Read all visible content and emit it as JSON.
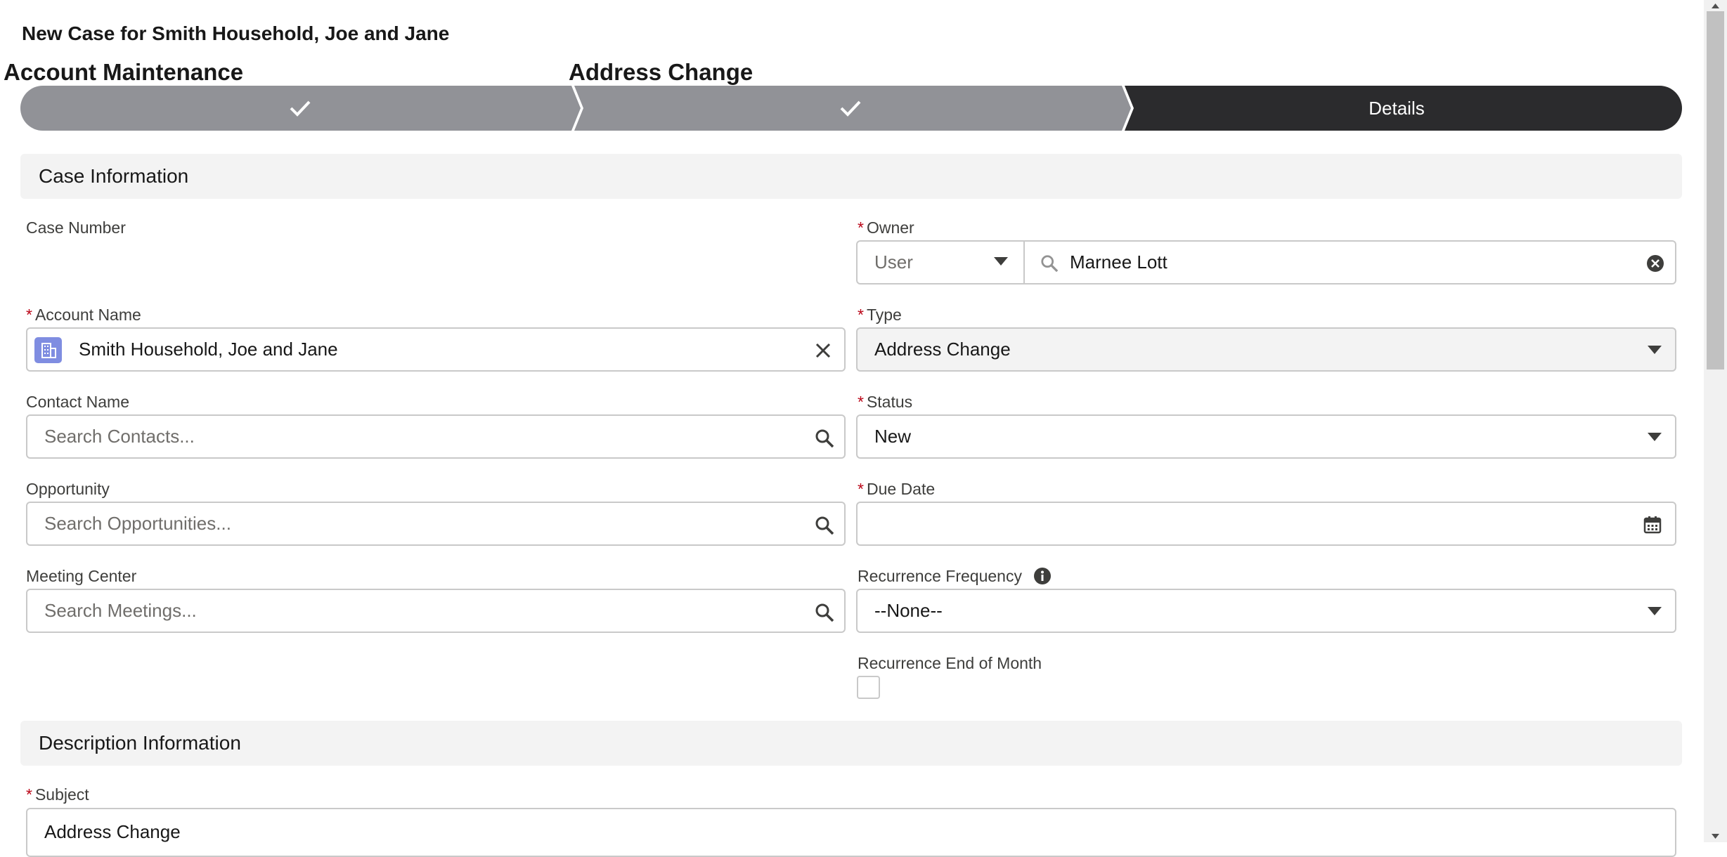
{
  "page": {
    "title": "New Case for Smith Household, Joe and Jane"
  },
  "path": {
    "step_titles": [
      "Account Maintenance",
      "Address Change"
    ],
    "stages": [
      {
        "status": "complete",
        "icon": "check-icon"
      },
      {
        "status": "complete",
        "icon": "check-icon"
      },
      {
        "status": "current",
        "label": "Details"
      }
    ]
  },
  "sections": {
    "case_information": "Case Information",
    "description_information": "Description Information"
  },
  "fields": {
    "case_number": {
      "label": "Case Number"
    },
    "owner": {
      "label": "Owner",
      "type_value": "User",
      "value": "Marnee Lott"
    },
    "account_name": {
      "label": "Account Name",
      "value": "Smith Household, Joe and Jane"
    },
    "type": {
      "label": "Type",
      "value": "Address Change"
    },
    "contact_name": {
      "label": "Contact Name",
      "placeholder": "Search Contacts..."
    },
    "status": {
      "label": "Status",
      "value": "New"
    },
    "opportunity": {
      "label": "Opportunity",
      "placeholder": "Search Opportunities..."
    },
    "due_date": {
      "label": "Due Date",
      "value": ""
    },
    "meeting_center": {
      "label": "Meeting Center",
      "placeholder": "Search Meetings..."
    },
    "recurrence_frequency": {
      "label": "Recurrence Frequency",
      "value": "--None--"
    },
    "recurrence_end_of_month": {
      "label": "Recurrence End of Month",
      "checked": false
    },
    "subject": {
      "label": "Subject",
      "value": "Address Change"
    }
  },
  "required_marker": "*",
  "colors": {
    "path_complete": "#919297",
    "path_current": "#2b2b2d",
    "section_bg": "#f3f3f3",
    "required": "#ba0517",
    "account_icon_bg": "#7f8de1"
  }
}
